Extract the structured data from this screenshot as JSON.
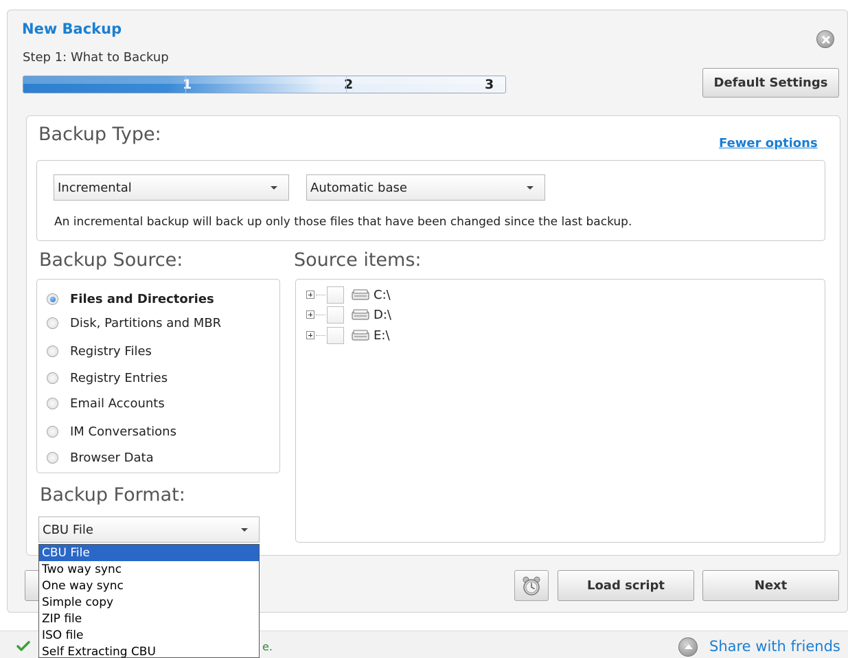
{
  "dialog": {
    "title": "New Backup",
    "step_label": "Step 1: What to Backup",
    "steps": [
      "1",
      "2",
      "3"
    ],
    "default_settings_label": "Default Settings"
  },
  "backup_type": {
    "heading": "Backup Type:",
    "fewer_options": "Fewer options",
    "type_value": "Incremental",
    "base_value": "Automatic base",
    "description": "An incremental backup will back up only those files that have been changed since the last backup."
  },
  "backup_source": {
    "heading": "Backup Source:",
    "options": [
      {
        "label": "Files and Directories",
        "checked": true
      },
      {
        "label": "Disk, Partitions and MBR",
        "checked": false
      },
      {
        "label": "Registry Files",
        "checked": false
      },
      {
        "label": "Registry Entries",
        "checked": false
      },
      {
        "label": "Email Accounts",
        "checked": false
      },
      {
        "label": "IM Conversations",
        "checked": false
      },
      {
        "label": "Browser Data",
        "checked": false
      }
    ]
  },
  "source_items": {
    "heading": "Source items:",
    "drives": [
      "C:\\",
      "D:\\",
      "E:\\"
    ]
  },
  "backup_format": {
    "heading": "Backup Format:",
    "value": "CBU File",
    "options": [
      "CBU File",
      "Two way sync",
      "One way sync",
      "Simple copy",
      "ZIP file",
      "ISO file",
      "Self Extracting CBU"
    ]
  },
  "footer": {
    "load_script_label": "Load script",
    "next_label": "Next"
  },
  "statusbar": {
    "status_text_fragment": "e.",
    "share_label": "Share with friends"
  }
}
